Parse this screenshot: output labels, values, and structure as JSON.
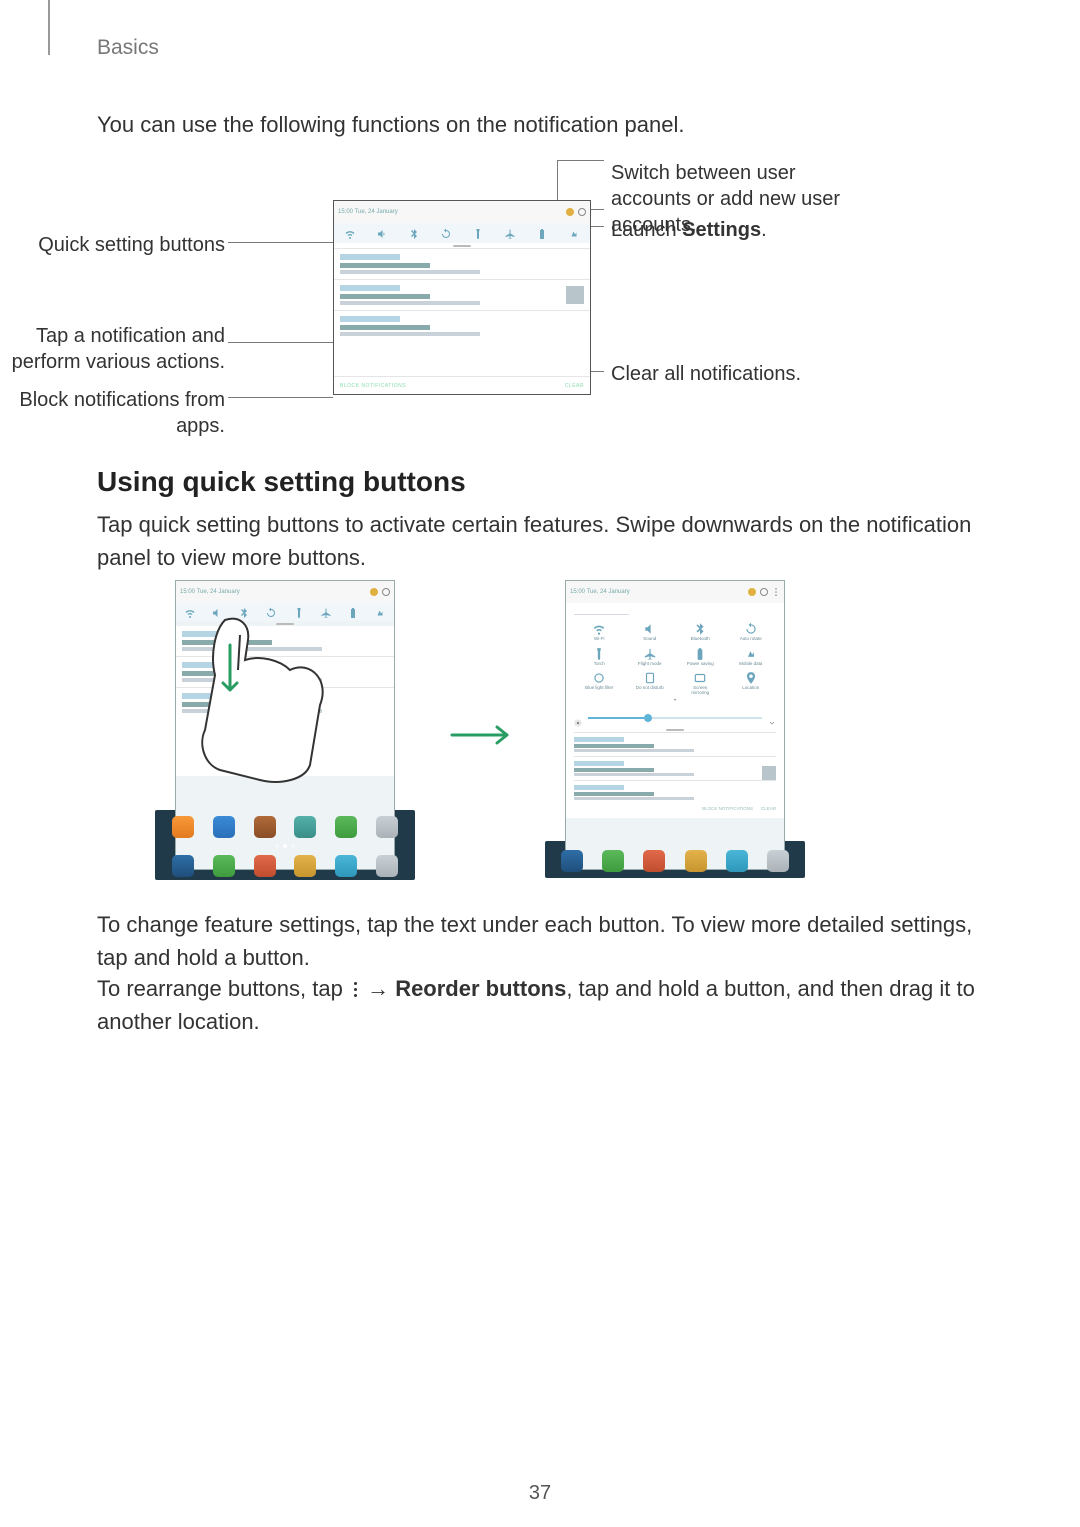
{
  "header": {
    "section": "Basics"
  },
  "intro": "You can use the following functions on the notification panel.",
  "callouts": {
    "quick_settings": "Quick setting buttons",
    "tap_notification": "Tap a notification and perform various actions.",
    "block": "Block notifications from apps.",
    "switch_user": "Switch between user accounts or add new user accounts.",
    "launch_settings_pre": "Launch ",
    "launch_settings_bold": "Settings",
    "launch_settings_post": ".",
    "clear_all": "Clear all notifications."
  },
  "section_heading": "Using quick setting buttons",
  "section_p1": "Tap quick setting buttons to activate certain features. Swipe downwards on the notification panel to view more buttons.",
  "para2_a": "To change feature settings, tap the text under each button. To view more detailed settings, tap and hold a button.",
  "para3_a": "To rearrange buttons, tap ",
  "para3_b_bold": "Reorder buttons",
  "para3_c": ", tap and hold a button, and then drag it to another location.",
  "arrow": "→",
  "panel": {
    "status_time": "15:00   Tue, 24 January",
    "footer_clear": "CLEAR",
    "footer_block": "BLOCK NOTIFICATIONS"
  },
  "qs_grid": [
    {
      "label": "Wi-Fi"
    },
    {
      "label": "Sound"
    },
    {
      "label": "Bluetooth"
    },
    {
      "label": "Auto rotate"
    },
    {
      "label": "Torch"
    },
    {
      "label": "Flight mode"
    },
    {
      "label": "Power saving"
    },
    {
      "label": "Mobile data"
    },
    {
      "label": "Blue light filter"
    },
    {
      "label": "Do not disturb"
    },
    {
      "label": "Screen mirroring"
    },
    {
      "label": "Location"
    }
  ],
  "page_number": "37"
}
